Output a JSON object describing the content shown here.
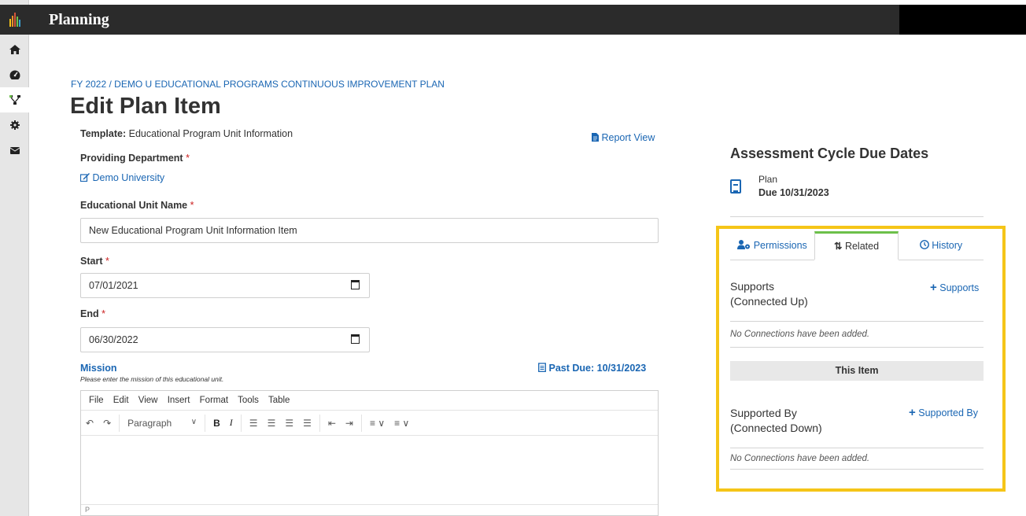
{
  "app": {
    "title": "Planning"
  },
  "sidebar": {
    "items": [
      {
        "icon": "home-icon",
        "active": false
      },
      {
        "icon": "dashboard-icon",
        "active": false
      },
      {
        "icon": "hierarchy-icon",
        "active": true
      },
      {
        "icon": "gear-icon",
        "active": false
      },
      {
        "icon": "envelope-icon",
        "active": false
      }
    ]
  },
  "breadcrumb": "FY 2022 / DEMO U EDUCATIONAL PROGRAMS CONTINUOUS IMPROVEMENT PLAN",
  "page_title": "Edit Plan Item",
  "form": {
    "template_label": "Template:",
    "template_value": "Educational Program Unit Information",
    "report_view": "Report View",
    "providing_department_label": "Providing Department",
    "providing_department_value": "Demo University",
    "unit_name_label": "Educational Unit Name",
    "unit_name_value": "New Educational Program Unit Information Item",
    "start_label": "Start",
    "start_value": "07/01/2021",
    "end_label": "End",
    "end_value": "06/30/2022",
    "required_mark": "*",
    "mission_label": "Mission",
    "mission_help": "Please enter the mission of this educational unit.",
    "mission_due": "Past Due: 10/31/2023"
  },
  "editor": {
    "menu": [
      "File",
      "Edit",
      "View",
      "Insert",
      "Format",
      "Tools",
      "Table"
    ],
    "block_format": "Paragraph",
    "status_path": "P"
  },
  "due_dates": {
    "title": "Assessment Cycle Due Dates",
    "item_name": "Plan",
    "item_due": "Due 10/31/2023"
  },
  "tabs": [
    {
      "label": "Permissions",
      "icon": "user-cog-icon",
      "active": false
    },
    {
      "label": "Related",
      "icon": "sort-arrows-icon",
      "active": true
    },
    {
      "label": "History",
      "icon": "clock-icon",
      "active": false
    }
  ],
  "related": {
    "supports_title": "Supports\n(Connected Up)",
    "supports_title_line1": "Supports",
    "supports_title_line2": "(Connected Up)",
    "supports_add": "Supports",
    "supports_empty": "No Connections have been added.",
    "this_item": "This Item",
    "supported_title_line1": "Supported By",
    "supported_title_line2": "(Connected Down)",
    "supported_add": "Supported By",
    "supported_empty": "No Connections have been added."
  },
  "colors": {
    "highlight": "#f5c518",
    "link": "#1a66b3",
    "active_tab": "#6cc04a",
    "topbar": "#2b2b2b"
  }
}
